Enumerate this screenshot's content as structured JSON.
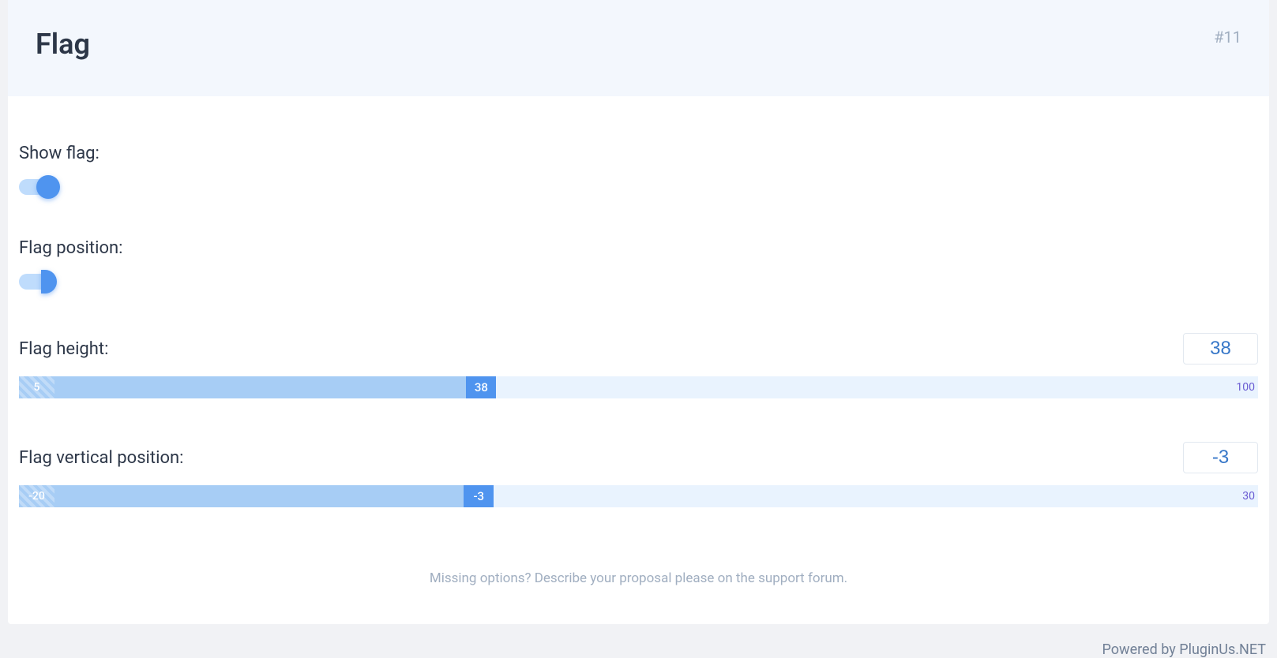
{
  "header": {
    "title": "Flag",
    "number": "#11"
  },
  "settings": {
    "show_flag": {
      "label": "Show flag:",
      "value": true
    },
    "flag_position": {
      "label": "Flag position:",
      "value": true
    },
    "flag_height": {
      "label": "Flag height:",
      "value": "38",
      "min": "5",
      "max": "100",
      "handle": "38",
      "fill_pct": 33.2,
      "handle_left_pct": 36.1
    },
    "flag_vertical_position": {
      "label": "Flag vertical position:",
      "value": "-3",
      "min": "-20",
      "max": "30",
      "handle": "-3",
      "fill_pct": 33.0,
      "handle_left_pct": 35.9
    }
  },
  "footer": {
    "text": "Missing options? Describe your proposal please on the support forum.",
    "powered": "Powered by PluginUs.NET"
  }
}
